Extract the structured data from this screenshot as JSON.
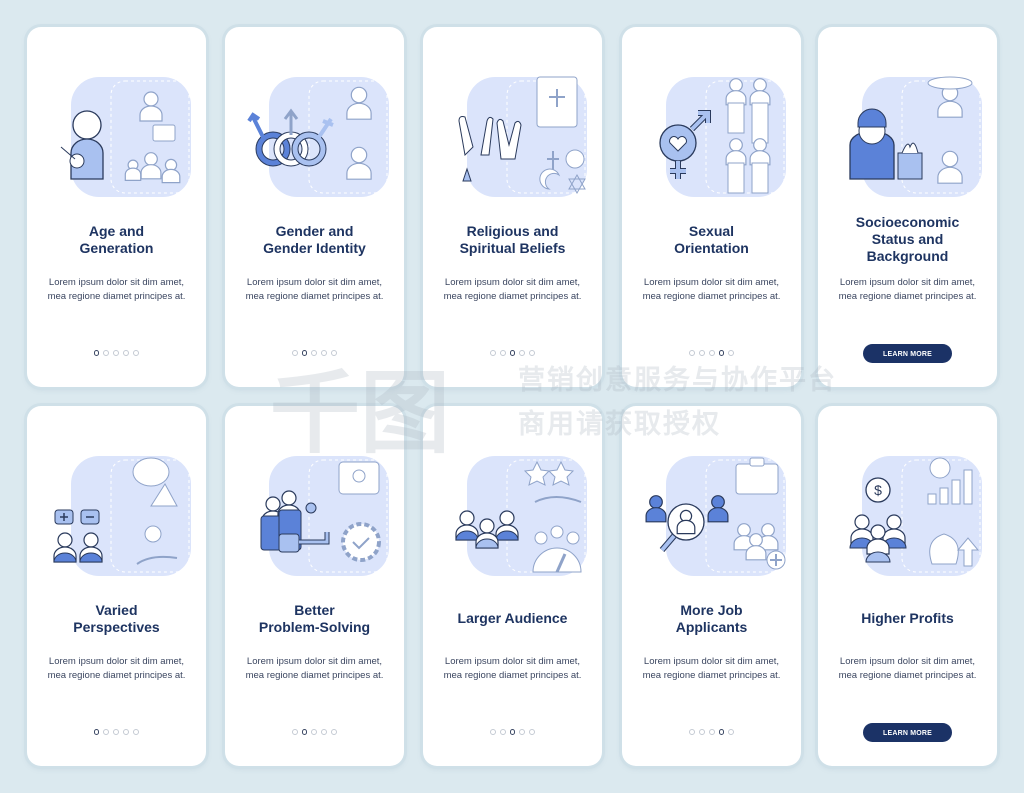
{
  "colors": {
    "background": "#dbe9ef",
    "card": "#ffffff",
    "title": "#1e3461",
    "body": "#3b4660",
    "accent": "#1b3266",
    "illus_fill": "#dbe4fb",
    "icon_dark": "#5b82d8",
    "icon_mid": "#a9c1f0"
  },
  "screens": [
    {
      "title": "Age and Generation",
      "title_lines": [
        "Age and",
        "Generation"
      ],
      "body": "Lorem ipsum dolor sit dim amet, mea regione diamet principes at.",
      "active_page": 1,
      "pages": 5,
      "illustration": "age-generation-illustration"
    },
    {
      "title": "Gender and Gender Identity",
      "title_lines": [
        "Gender and",
        "Gender Identity"
      ],
      "body": "Lorem ipsum dolor sit dim amet, mea regione diamet principes at.",
      "active_page": 2,
      "pages": 5,
      "illustration": "gender-symbols-illustration"
    },
    {
      "title": "Religious and Spiritual Beliefs",
      "title_lines": [
        "Religious and",
        "Spiritual Beliefs"
      ],
      "body": "Lorem ipsum dolor sit dim amet, mea regione diamet principes at.",
      "active_page": 3,
      "pages": 5,
      "illustration": "praying-hands-illustration"
    },
    {
      "title": "Sexual Orientation",
      "title_lines": [
        "Sexual",
        "Orientation"
      ],
      "body": "Lorem ipsum dolor sit dim amet, mea regione diamet principes at.",
      "active_page": 4,
      "pages": 5,
      "illustration": "couples-illustration"
    },
    {
      "title": "Socioeconomic Status and Background",
      "title_lines": [
        "Socioeconomic",
        "Status and",
        "Background"
      ],
      "body": "Lorem ipsum dolor sit dim amet, mea regione diamet principes at.",
      "button": "LEARN MORE",
      "illustration": "socioeconomic-illustration"
    },
    {
      "title": "Varied Perspectives",
      "title_lines": [
        "Varied",
        "Perspectives"
      ],
      "body": "Lorem ipsum dolor sit dim amet, mea regione diamet principes at.",
      "active_page": 1,
      "pages": 5,
      "illustration": "perspectives-illustration"
    },
    {
      "title": "Better Problem-Solving",
      "title_lines": [
        "Better",
        "Problem-Solving"
      ],
      "body": "Lorem ipsum dolor sit dim amet, mea regione diamet principes at.",
      "active_page": 2,
      "pages": 5,
      "illustration": "key-gear-illustration"
    },
    {
      "title": "Larger Audience",
      "title_lines": [
        "Larger Audience"
      ],
      "body": "Lorem ipsum dolor sit dim amet, mea regione diamet principes at.",
      "active_page": 3,
      "pages": 5,
      "illustration": "audience-illustration"
    },
    {
      "title": "More Job Applicants",
      "title_lines": [
        "More Job",
        "Applicants"
      ],
      "body": "Lorem ipsum dolor sit dim amet, mea regione diamet principes at.",
      "active_page": 4,
      "pages": 5,
      "illustration": "job-search-illustration"
    },
    {
      "title": "Higher Profits",
      "title_lines": [
        "Higher Profits"
      ],
      "body": "Lorem ipsum dolor sit dim amet, mea regione diamet principes at.",
      "button": "LEARN MORE",
      "illustration": "profits-illustration"
    }
  ],
  "watermark": {
    "logo": "千图",
    "line1": "营销创意服务与协作平台",
    "line2": "商用请获取授权"
  }
}
